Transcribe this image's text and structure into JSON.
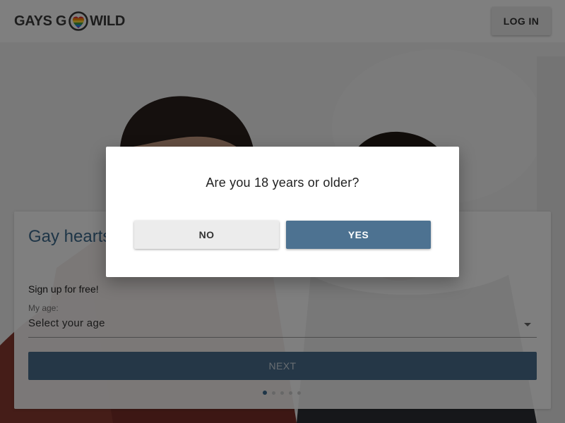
{
  "header": {
    "logo": {
      "text_before": "GAYS G",
      "text_after": "WILD",
      "icon": "rainbow-heart-icon"
    },
    "login_label": "LOG IN"
  },
  "hero": {
    "image": "two-men-photo"
  },
  "signup_card": {
    "title": "Gay hearts are united",
    "subtitle": "Sign up for free!",
    "age_label": "My age:",
    "age_select": {
      "value": "Select your age",
      "icon": "chevron-down-icon"
    },
    "next_label": "NEXT",
    "steps": {
      "current": 1,
      "total": 5
    }
  },
  "modal": {
    "question": "Are you 18 years or older?",
    "no_label": "NO",
    "yes_label": "YES"
  },
  "colors": {
    "brand_blue": "#4d7291",
    "title_blue": "#3d6b8e",
    "overlay": "rgba(0,0,0,0.5)"
  }
}
